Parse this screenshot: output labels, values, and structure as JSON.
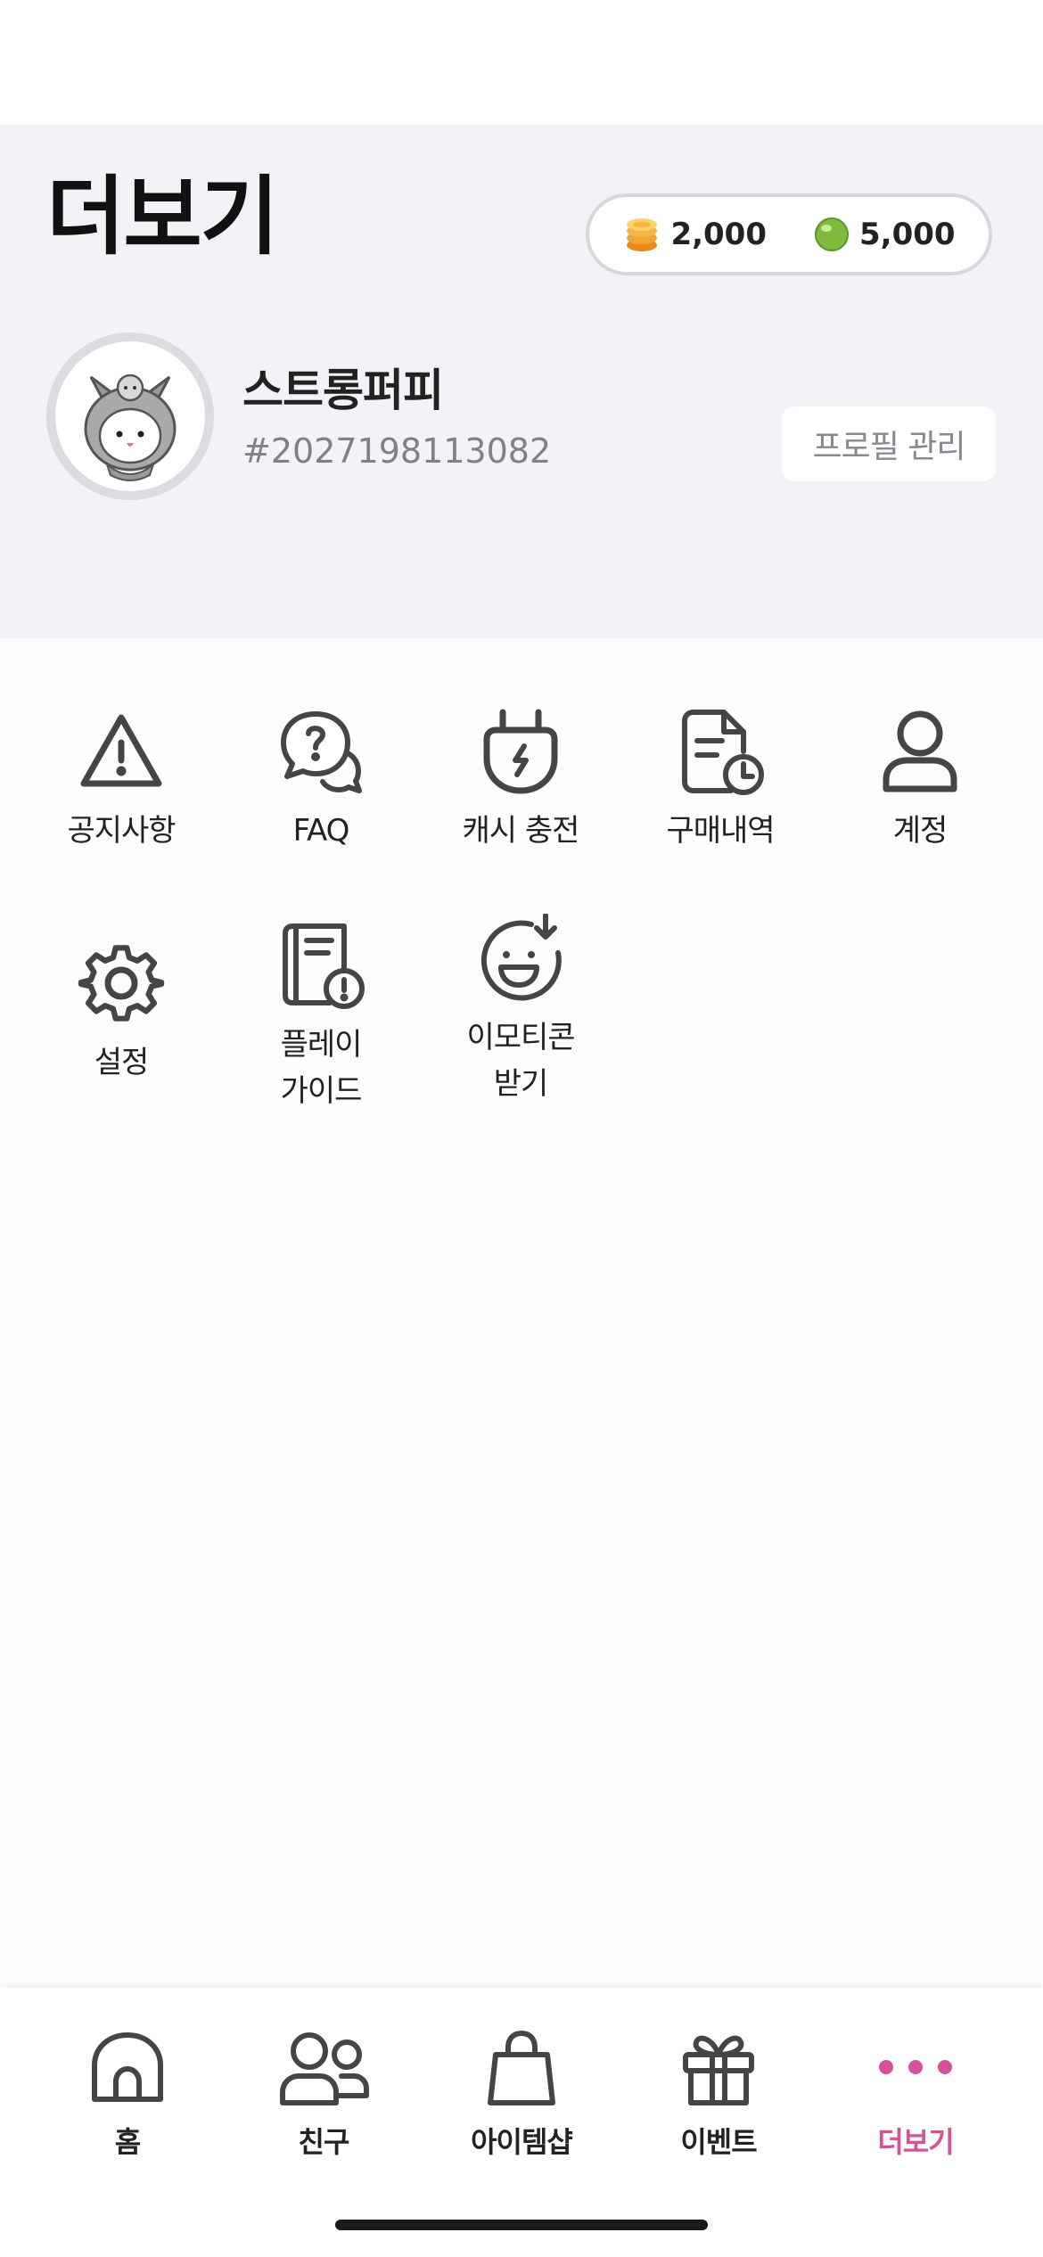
{
  "header": {
    "title": "더보기",
    "currency": {
      "coins": {
        "icon": "coin-stack-icon",
        "amount": "2,000"
      },
      "gems": {
        "icon": "green-orb-icon",
        "amount": "5,000"
      }
    },
    "profile": {
      "avatar": "bunny-hood-avatar",
      "nickname": "스트롱퍼피",
      "user_id": "#2027198113082",
      "manage_label": "프로필 관리"
    }
  },
  "menu": [
    {
      "id": "notice",
      "label": "공지사항",
      "icon": "warning-triangle-icon"
    },
    {
      "id": "faq",
      "label": "FAQ",
      "icon": "question-chat-icon"
    },
    {
      "id": "cash-charge",
      "label": "캐시 충전",
      "icon": "charger-plug-icon"
    },
    {
      "id": "purchase-history",
      "label": "구매내역",
      "icon": "receipt-clock-icon"
    },
    {
      "id": "account",
      "label": "계정",
      "icon": "person-icon"
    },
    {
      "id": "settings",
      "label": "설정",
      "icon": "gear-icon"
    },
    {
      "id": "play-guide",
      "label": "플레이\n가이드",
      "icon": "guide-book-icon"
    },
    {
      "id": "emoticon",
      "label": "이모티콘\n받기",
      "icon": "smiley-download-icon"
    }
  ],
  "tabs": [
    {
      "id": "home",
      "label": "홈",
      "icon": "house-icon",
      "active": false
    },
    {
      "id": "friends",
      "label": "친구",
      "icon": "friends-icon",
      "active": false
    },
    {
      "id": "item-shop",
      "label": "아이템샵",
      "icon": "shopping-bag-icon",
      "active": false
    },
    {
      "id": "event",
      "label": "이벤트",
      "icon": "gift-icon",
      "active": false
    },
    {
      "id": "more",
      "label": "더보기",
      "icon": "more-dots-icon",
      "active": true
    }
  ],
  "colors": {
    "accent": "#d9509a",
    "header_bg": "#f3f2f6",
    "icon_stroke": "#454545"
  }
}
